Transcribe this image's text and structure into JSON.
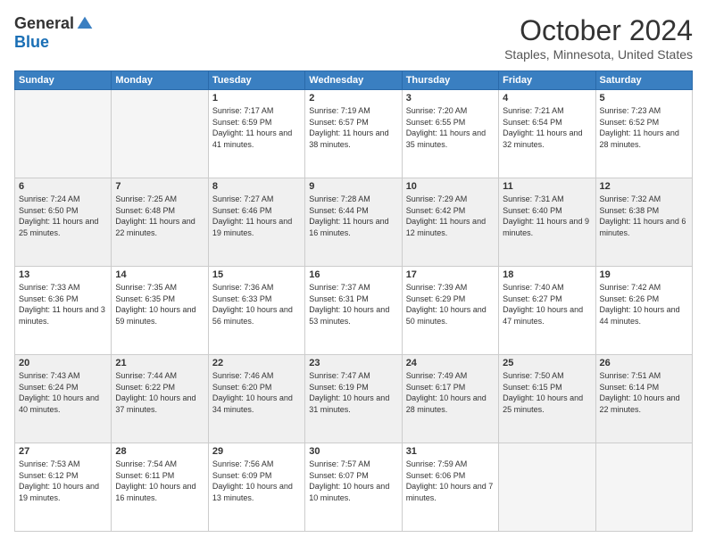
{
  "logo": {
    "general": "General",
    "blue": "Blue"
  },
  "title": "October 2024",
  "location": "Staples, Minnesota, United States",
  "days_of_week": [
    "Sunday",
    "Monday",
    "Tuesday",
    "Wednesday",
    "Thursday",
    "Friday",
    "Saturday"
  ],
  "weeks": [
    [
      {
        "day": "",
        "info": ""
      },
      {
        "day": "",
        "info": ""
      },
      {
        "day": "1",
        "sunrise": "Sunrise: 7:17 AM",
        "sunset": "Sunset: 6:59 PM",
        "daylight": "Daylight: 11 hours and 41 minutes."
      },
      {
        "day": "2",
        "sunrise": "Sunrise: 7:19 AM",
        "sunset": "Sunset: 6:57 PM",
        "daylight": "Daylight: 11 hours and 38 minutes."
      },
      {
        "day": "3",
        "sunrise": "Sunrise: 7:20 AM",
        "sunset": "Sunset: 6:55 PM",
        "daylight": "Daylight: 11 hours and 35 minutes."
      },
      {
        "day": "4",
        "sunrise": "Sunrise: 7:21 AM",
        "sunset": "Sunset: 6:54 PM",
        "daylight": "Daylight: 11 hours and 32 minutes."
      },
      {
        "day": "5",
        "sunrise": "Sunrise: 7:23 AM",
        "sunset": "Sunset: 6:52 PM",
        "daylight": "Daylight: 11 hours and 28 minutes."
      }
    ],
    [
      {
        "day": "6",
        "sunrise": "Sunrise: 7:24 AM",
        "sunset": "Sunset: 6:50 PM",
        "daylight": "Daylight: 11 hours and 25 minutes."
      },
      {
        "day": "7",
        "sunrise": "Sunrise: 7:25 AM",
        "sunset": "Sunset: 6:48 PM",
        "daylight": "Daylight: 11 hours and 22 minutes."
      },
      {
        "day": "8",
        "sunrise": "Sunrise: 7:27 AM",
        "sunset": "Sunset: 6:46 PM",
        "daylight": "Daylight: 11 hours and 19 minutes."
      },
      {
        "day": "9",
        "sunrise": "Sunrise: 7:28 AM",
        "sunset": "Sunset: 6:44 PM",
        "daylight": "Daylight: 11 hours and 16 minutes."
      },
      {
        "day": "10",
        "sunrise": "Sunrise: 7:29 AM",
        "sunset": "Sunset: 6:42 PM",
        "daylight": "Daylight: 11 hours and 12 minutes."
      },
      {
        "day": "11",
        "sunrise": "Sunrise: 7:31 AM",
        "sunset": "Sunset: 6:40 PM",
        "daylight": "Daylight: 11 hours and 9 minutes."
      },
      {
        "day": "12",
        "sunrise": "Sunrise: 7:32 AM",
        "sunset": "Sunset: 6:38 PM",
        "daylight": "Daylight: 11 hours and 6 minutes."
      }
    ],
    [
      {
        "day": "13",
        "sunrise": "Sunrise: 7:33 AM",
        "sunset": "Sunset: 6:36 PM",
        "daylight": "Daylight: 11 hours and 3 minutes."
      },
      {
        "day": "14",
        "sunrise": "Sunrise: 7:35 AM",
        "sunset": "Sunset: 6:35 PM",
        "daylight": "Daylight: 10 hours and 59 minutes."
      },
      {
        "day": "15",
        "sunrise": "Sunrise: 7:36 AM",
        "sunset": "Sunset: 6:33 PM",
        "daylight": "Daylight: 10 hours and 56 minutes."
      },
      {
        "day": "16",
        "sunrise": "Sunrise: 7:37 AM",
        "sunset": "Sunset: 6:31 PM",
        "daylight": "Daylight: 10 hours and 53 minutes."
      },
      {
        "day": "17",
        "sunrise": "Sunrise: 7:39 AM",
        "sunset": "Sunset: 6:29 PM",
        "daylight": "Daylight: 10 hours and 50 minutes."
      },
      {
        "day": "18",
        "sunrise": "Sunrise: 7:40 AM",
        "sunset": "Sunset: 6:27 PM",
        "daylight": "Daylight: 10 hours and 47 minutes."
      },
      {
        "day": "19",
        "sunrise": "Sunrise: 7:42 AM",
        "sunset": "Sunset: 6:26 PM",
        "daylight": "Daylight: 10 hours and 44 minutes."
      }
    ],
    [
      {
        "day": "20",
        "sunrise": "Sunrise: 7:43 AM",
        "sunset": "Sunset: 6:24 PM",
        "daylight": "Daylight: 10 hours and 40 minutes."
      },
      {
        "day": "21",
        "sunrise": "Sunrise: 7:44 AM",
        "sunset": "Sunset: 6:22 PM",
        "daylight": "Daylight: 10 hours and 37 minutes."
      },
      {
        "day": "22",
        "sunrise": "Sunrise: 7:46 AM",
        "sunset": "Sunset: 6:20 PM",
        "daylight": "Daylight: 10 hours and 34 minutes."
      },
      {
        "day": "23",
        "sunrise": "Sunrise: 7:47 AM",
        "sunset": "Sunset: 6:19 PM",
        "daylight": "Daylight: 10 hours and 31 minutes."
      },
      {
        "day": "24",
        "sunrise": "Sunrise: 7:49 AM",
        "sunset": "Sunset: 6:17 PM",
        "daylight": "Daylight: 10 hours and 28 minutes."
      },
      {
        "day": "25",
        "sunrise": "Sunrise: 7:50 AM",
        "sunset": "Sunset: 6:15 PM",
        "daylight": "Daylight: 10 hours and 25 minutes."
      },
      {
        "day": "26",
        "sunrise": "Sunrise: 7:51 AM",
        "sunset": "Sunset: 6:14 PM",
        "daylight": "Daylight: 10 hours and 22 minutes."
      }
    ],
    [
      {
        "day": "27",
        "sunrise": "Sunrise: 7:53 AM",
        "sunset": "Sunset: 6:12 PM",
        "daylight": "Daylight: 10 hours and 19 minutes."
      },
      {
        "day": "28",
        "sunrise": "Sunrise: 7:54 AM",
        "sunset": "Sunset: 6:11 PM",
        "daylight": "Daylight: 10 hours and 16 minutes."
      },
      {
        "day": "29",
        "sunrise": "Sunrise: 7:56 AM",
        "sunset": "Sunset: 6:09 PM",
        "daylight": "Daylight: 10 hours and 13 minutes."
      },
      {
        "day": "30",
        "sunrise": "Sunrise: 7:57 AM",
        "sunset": "Sunset: 6:07 PM",
        "daylight": "Daylight: 10 hours and 10 minutes."
      },
      {
        "day": "31",
        "sunrise": "Sunrise: 7:59 AM",
        "sunset": "Sunset: 6:06 PM",
        "daylight": "Daylight: 10 hours and 7 minutes."
      },
      {
        "day": "",
        "info": ""
      },
      {
        "day": "",
        "info": ""
      }
    ]
  ]
}
